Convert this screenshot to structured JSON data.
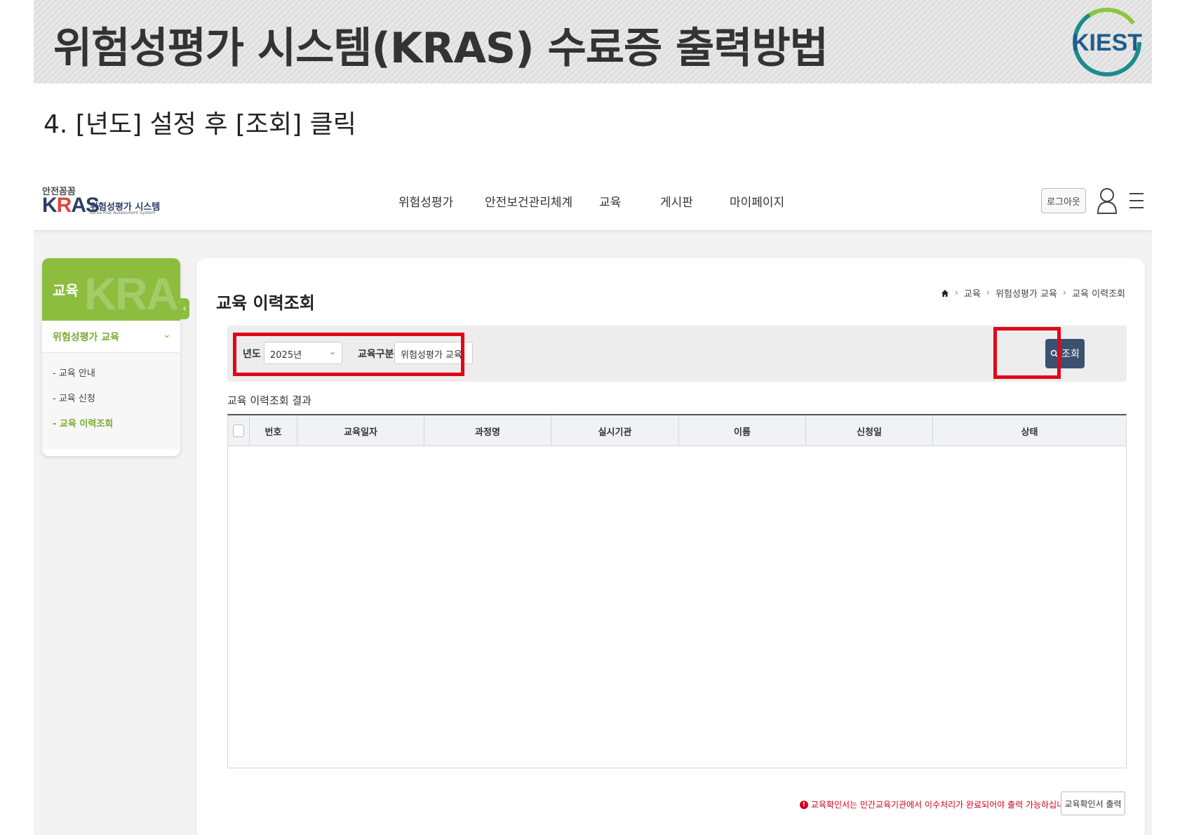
{
  "slide": {
    "title": "위험성평가 시스템(KRAS) 수료증 출력방법",
    "logo_text": "KIEST",
    "step": "4. [년도] 설정 후 [조회] 클릭",
    "highlight_color": "#e0061a"
  },
  "header": {
    "logo_top": "안전꼼꼼",
    "logo_main_k": "K",
    "logo_main_r": "R",
    "logo_main_as": "AS",
    "logo_sub": "위험성평가 시스템",
    "logo_tiny": "Korea Risk Assessment System",
    "nav": [
      "위험성평가",
      "안전보건관리체계",
      "교육",
      "게시판",
      "마이페이지"
    ],
    "logout_label": "로그아웃",
    "icons": [
      "user-icon",
      "menu-icon"
    ]
  },
  "sidebar": {
    "title": "교육",
    "watermark": "KRAS",
    "category": "위험성평가 교육",
    "items": [
      {
        "label": "- 교육 안내"
      },
      {
        "label": "- 교육 신청"
      },
      {
        "label": "- 교육 이력조회"
      }
    ],
    "active_index": 2,
    "accent_color": "#8cbd3f"
  },
  "content": {
    "title": "교육 이력조회",
    "breadcrumb": [
      "교육",
      "위험성평가 교육",
      "교육 이력조회"
    ],
    "filters": {
      "year_label": "년도",
      "year_value": "2025년",
      "type_label": "교육구분",
      "type_value": "위험성평가 교육"
    },
    "search_label": "조회",
    "result_label": "교육 이력조회 결과",
    "columns": [
      "번호",
      "교육일자",
      "과정명",
      "실시기관",
      "이름",
      "신청일",
      "상태"
    ],
    "rows": [],
    "notice": "교육확인서는 민간교육기관에서 이수처리가 완료되어야 출력 가능하십니다.",
    "print_label": "교육확인서 출력"
  }
}
